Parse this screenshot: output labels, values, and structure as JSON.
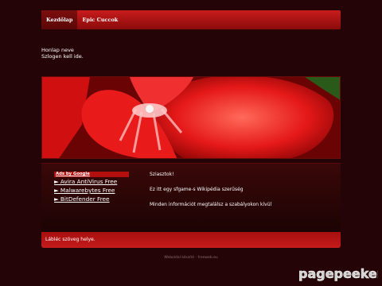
{
  "nav": {
    "items": [
      {
        "label": "Kezdőlap",
        "active": true
      },
      {
        "label": "Epic Cuccok",
        "active": false
      }
    ]
  },
  "site": {
    "name": "Honlap neve",
    "slogen": "Szlogen kell ide."
  },
  "banner": {
    "image": "red geranium flower photo"
  },
  "ads": {
    "title": "Ads by Google",
    "links": [
      "► Avira AntiVirus Free",
      "► Malwarebytes Free",
      "► BitDefender Free"
    ]
  },
  "main": {
    "paragraphs": [
      "Sziasztok!",
      "Ez itt egy sfgame-s Wikipédia szerűség",
      "Minden információt megtalálsz a szabályokon kívül"
    ]
  },
  "footer": {
    "text": "Lábléc szöveg helye."
  },
  "credit": {
    "text": "Weboldal készítő - freeweb.eu"
  },
  "watermark": {
    "text": "pagepeeker"
  },
  "colors": {
    "accent": "#c81c1c",
    "background": "#240406"
  }
}
